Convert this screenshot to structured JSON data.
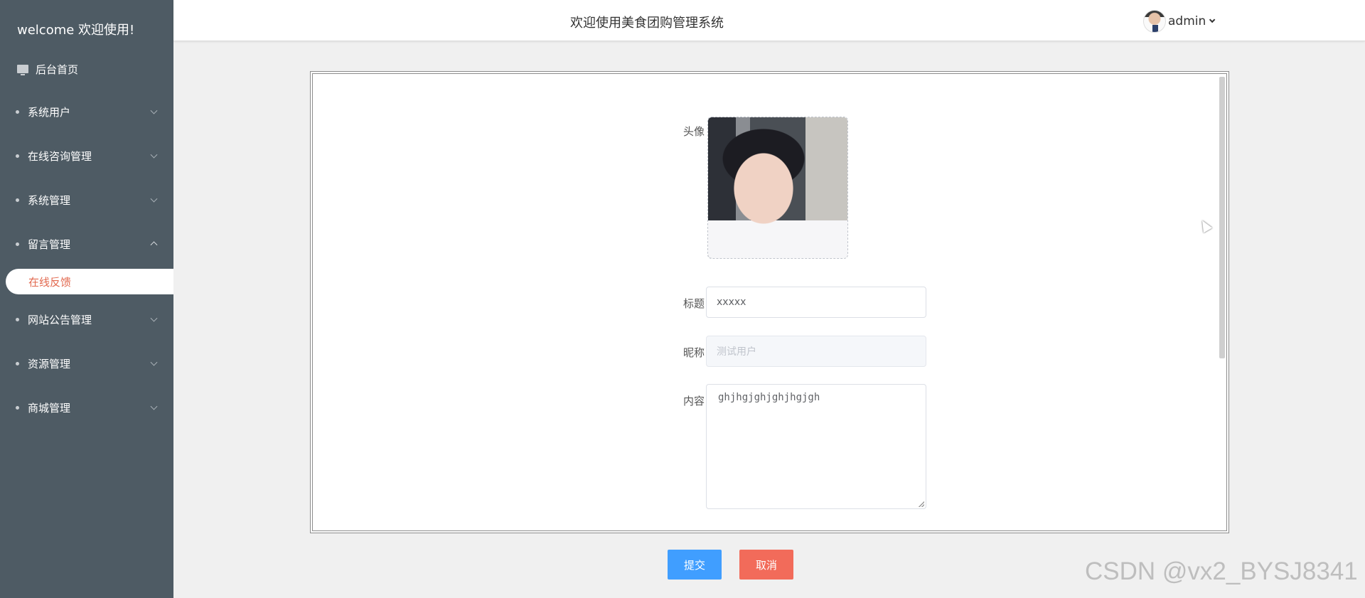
{
  "sidebar": {
    "brand": "welcome 欢迎使用!",
    "home": "后台首页",
    "items": [
      {
        "label": "系统用户"
      },
      {
        "label": "在线咨询管理"
      },
      {
        "label": "系统管理"
      },
      {
        "label": "留言管理"
      },
      {
        "label": "网站公告管理"
      },
      {
        "label": "资源管理"
      },
      {
        "label": "商城管理"
      }
    ],
    "active_sub": "在线反馈"
  },
  "header": {
    "title": "欢迎使用美食团购管理系统",
    "user": "admin"
  },
  "form": {
    "avatar_label": "头像",
    "title_label": "标题",
    "title_value": "xxxxx",
    "nickname_label": "昵称",
    "nickname_value": "测试用户",
    "content_label": "内容",
    "content_value": "ghjhgjghjghjhgjgh"
  },
  "actions": {
    "submit": "提交",
    "cancel": "取消"
  },
  "watermark": "CSDN @vx2_BYSJ8341",
  "colors": {
    "sidebar_bg": "#4e5b64",
    "active_text": "#e2694f",
    "submit_bg": "#409eff",
    "cancel_bg": "#f26b5a"
  }
}
